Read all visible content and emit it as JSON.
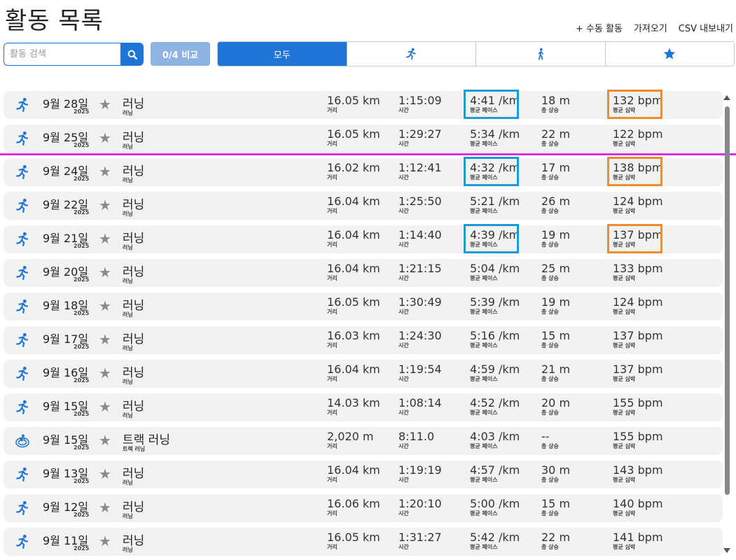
{
  "page": {
    "title": "활동 목록",
    "actions": [
      "+ 수동 활동",
      "가져오기",
      "CSV 내보내기"
    ]
  },
  "search": {
    "placeholder": "활동 검색"
  },
  "compare": {
    "label": "0/4 비교"
  },
  "filters": [
    {
      "label": "모두",
      "icon": "",
      "active": true
    },
    {
      "label": "",
      "icon": "running-icon",
      "active": false
    },
    {
      "label": "",
      "icon": "walking-icon",
      "active": false
    },
    {
      "label": "",
      "icon": "star-icon",
      "active": false
    }
  ],
  "labels": {
    "distance": "거리",
    "time": "시간",
    "pace": "평균 페이스",
    "elevation": "총 상승",
    "hr": "평균 심박"
  },
  "activities": [
    {
      "date": "9월 28일",
      "year": "2025",
      "name": "러닝",
      "type": "러닝",
      "icon": "running-icon",
      "distance": "16.05 km",
      "time": "1:15:09",
      "pace": "4:41 /km",
      "elevation": "18 m",
      "hr": "132 bpm",
      "hl_pace": true,
      "hl_hr": true
    },
    {
      "date": "9월 25일",
      "year": "2025",
      "name": "러닝",
      "type": "러닝",
      "icon": "running-icon",
      "distance": "16.05 km",
      "time": "1:29:27",
      "pace": "5:34 /km",
      "elevation": "22 m",
      "hr": "122 bpm",
      "hl_pace": false,
      "hl_hr": false
    },
    {
      "date": "9월 24일",
      "year": "2025",
      "name": "러닝",
      "type": "러닝",
      "icon": "running-icon",
      "distance": "16.02 km",
      "time": "1:12:41",
      "pace": "4:32 /km",
      "elevation": "17 m",
      "hr": "138 bpm",
      "hl_pace": true,
      "hl_hr": true
    },
    {
      "date": "9월 22일",
      "year": "2025",
      "name": "러닝",
      "type": "러닝",
      "icon": "running-icon",
      "distance": "16.04 km",
      "time": "1:25:50",
      "pace": "5:21 /km",
      "elevation": "26 m",
      "hr": "124 bpm",
      "hl_pace": false,
      "hl_hr": false
    },
    {
      "date": "9월 21일",
      "year": "2025",
      "name": "러닝",
      "type": "러닝",
      "icon": "running-icon",
      "distance": "16.04 km",
      "time": "1:14:40",
      "pace": "4:39 /km",
      "elevation": "19 m",
      "hr": "137 bpm",
      "hl_pace": true,
      "hl_hr": true
    },
    {
      "date": "9월 20일",
      "year": "2025",
      "name": "러닝",
      "type": "러닝",
      "icon": "running-icon",
      "distance": "16.04 km",
      "time": "1:21:15",
      "pace": "5:04 /km",
      "elevation": "25 m",
      "hr": "133 bpm",
      "hl_pace": false,
      "hl_hr": false
    },
    {
      "date": "9월 18일",
      "year": "2025",
      "name": "러닝",
      "type": "러닝",
      "icon": "running-icon",
      "distance": "16.05 km",
      "time": "1:30:49",
      "pace": "5:39 /km",
      "elevation": "19 m",
      "hr": "124 bpm",
      "hl_pace": false,
      "hl_hr": false
    },
    {
      "date": "9월 17일",
      "year": "2025",
      "name": "러닝",
      "type": "러닝",
      "icon": "running-icon",
      "distance": "16.03 km",
      "time": "1:24:30",
      "pace": "5:16 /km",
      "elevation": "15 m",
      "hr": "137 bpm",
      "hl_pace": false,
      "hl_hr": false
    },
    {
      "date": "9월 16일",
      "year": "2025",
      "name": "러닝",
      "type": "러닝",
      "icon": "running-icon",
      "distance": "16.04 km",
      "time": "1:19:54",
      "pace": "4:59 /km",
      "elevation": "21 m",
      "hr": "137 bpm",
      "hl_pace": false,
      "hl_hr": false
    },
    {
      "date": "9월 15일",
      "year": "2025",
      "name": "러닝",
      "type": "러닝",
      "icon": "running-icon",
      "distance": "14.03 km",
      "time": "1:08:14",
      "pace": "4:52 /km",
      "elevation": "20 m",
      "hr": "155 bpm",
      "hl_pace": false,
      "hl_hr": false
    },
    {
      "date": "9월 15일",
      "year": "2025",
      "name": "트랙 러닝",
      "type": "트랙 러닝",
      "icon": "track-running-icon",
      "distance": "2,020 m",
      "time": "8:11.0",
      "pace": "4:03 /km",
      "elevation": "--",
      "hr": "155 bpm",
      "hl_pace": false,
      "hl_hr": false
    },
    {
      "date": "9월 13일",
      "year": "2025",
      "name": "러닝",
      "type": "러닝",
      "icon": "running-icon",
      "distance": "16.04 km",
      "time": "1:19:19",
      "pace": "4:57 /km",
      "elevation": "30 m",
      "hr": "143 bpm",
      "hl_pace": false,
      "hl_hr": false
    },
    {
      "date": "9월 12일",
      "year": "2025",
      "name": "러닝",
      "type": "러닝",
      "icon": "running-icon",
      "distance": "16.06 km",
      "time": "1:20:10",
      "pace": "5:00 /km",
      "elevation": "15 m",
      "hr": "140 bpm",
      "hl_pace": false,
      "hl_hr": false
    },
    {
      "date": "9월 11일",
      "year": "2025",
      "name": "러닝",
      "type": "러닝",
      "icon": "running-icon",
      "distance": "16.05 km",
      "time": "1:31:27",
      "pace": "5:42 /km",
      "elevation": "22 m",
      "hr": "141 bpm",
      "hl_pace": false,
      "hl_hr": false
    }
  ],
  "colors": {
    "accent": "#1f75d6",
    "compare_disabled": "#8db3e2",
    "highlight_pace": "#1e9bd7",
    "highlight_hr": "#f28a2e",
    "divider": "#d633e0",
    "row_bg": "#f2f2f2"
  }
}
